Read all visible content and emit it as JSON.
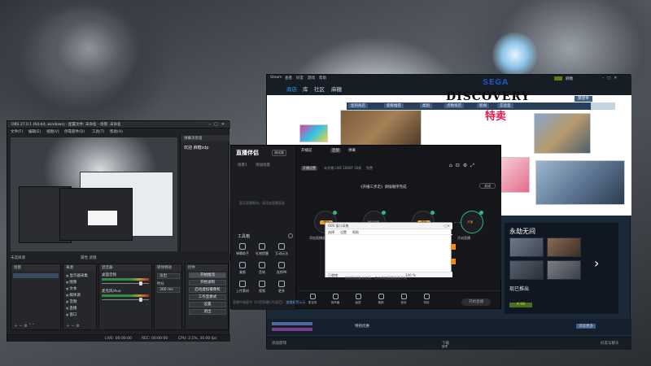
{
  "colors": {
    "steam_bg": "#1b2838",
    "steam_accent": "#1a9fff",
    "live_bg": "#15161a",
    "live_accent": "#2db784",
    "obs_bg": "#1f2124",
    "sega_blue": "#1f4fb5",
    "spring_red": "#e01d4f"
  },
  "obs": {
    "title": "OBS 27.0.1 (64-bit, windows) - 配置文件: 未命名 - 场景: 未命名",
    "menu": [
      "文件(F)",
      "编辑(E)",
      "视图(V)",
      "停靠部件(D)",
      "工具(T)",
      "帮助(H)"
    ],
    "chat": {
      "header": "弹幕消息窗",
      "message": "欢迎 麻糖zdp"
    },
    "status_left": "未选择源",
    "status_right": "属性  滤镜",
    "docks": {
      "scenes": "场景",
      "sources": "来源",
      "mixer": "混音器",
      "transitions": "转场特效",
      "controls": "控件"
    },
    "sources": [
      "显示器采集",
      "图像",
      "文本",
      "媒体源",
      "音频",
      "直播",
      "窗口"
    ],
    "mixer_rows": [
      "桌面音频",
      "麦克风/Aux"
    ],
    "transition": {
      "type": "淡出",
      "duration_label": "时长",
      "duration": "300 ms"
    },
    "controls": [
      "开始推流",
      "开始录制",
      "启动虚拟摄像机",
      "工作室模式",
      "设置",
      "退出"
    ],
    "bottom_status": [
      "LIVE: 00:00:00",
      "REC: 00:00:00",
      "CPU: 2.1%, 30.00 fps"
    ]
  },
  "steam": {
    "menu": [
      "Steam",
      "查看",
      "好友",
      "游戏",
      "帮助"
    ],
    "nav": [
      "商店",
      "库",
      "社区",
      "麻糖"
    ],
    "account_label": "麻糖",
    "store_tabs": [
      "您的商店",
      "新鲜推荐",
      "类别",
      "点数商店",
      "新闻",
      "实验室"
    ],
    "cart_label": "愿望单",
    "sega": "SEGA",
    "discovery": "DISCOVERY",
    "spring": "特卖",
    "feature": {
      "title": "永劫无间",
      "sub": "现已推出",
      "price": "¥ 98"
    },
    "bottom_strip": [
      "特别优惠",
      "浏览更多"
    ],
    "footer": [
      "添加游戏",
      "下载",
      "管理",
      "好友与聊天"
    ]
  },
  "live": {
    "logo": "直播伴侣",
    "badge": "测试版",
    "scene_tabs": [
      "场景1",
      "添加场景"
    ],
    "hint": "暂无直播素材，请添加直播画面",
    "tools_title": "工具箱",
    "tools": [
      [
        "弹幕助手",
        "礼物提醒",
        "互动玩法"
      ],
      [
        "美颜",
        "音效",
        "连线PK"
      ],
      [
        "上传素材",
        "视频",
        "更多"
      ]
    ],
    "notice_prefix": "直播中请遵守《抖音直播行为规范》",
    "notice_link": "违规处罚公示",
    "header": {
      "title": "开播前",
      "pill": "连接",
      "chat": "弹幕"
    },
    "sub": {
      "chip": "开播设置",
      "info": "未开播 LIVE 1080P 30帧",
      "extra": "免费"
    },
    "flow_title": "《开播三步走》请按顺序完成",
    "close_pill": "关闭",
    "nodes": [
      {
        "tag": "添加",
        "label": "添加直播画面"
      },
      {
        "tag": "",
        "label": "检测设备"
      },
      {
        "tag": "开始",
        "label": "配置直播信息"
      },
      {
        "tag": "",
        "label": "开始直播"
      }
    ],
    "node_names": [
      "画面",
      "NO LIVE",
      "信息",
      "开播"
    ],
    "dialog": {
      "title": "OBS 窗口采集",
      "menu": [
        "选择",
        "设置",
        "帮助"
      ],
      "status_left": "已就绪",
      "status_right": "100 %"
    },
    "bottom_note": "检测到设备未连接，点击添加直播画面开始",
    "toolbar": [
      "麦克风",
      "扬声器",
      "画质",
      "美颜",
      "音效",
      "特效"
    ],
    "start_label": "开始直播"
  }
}
